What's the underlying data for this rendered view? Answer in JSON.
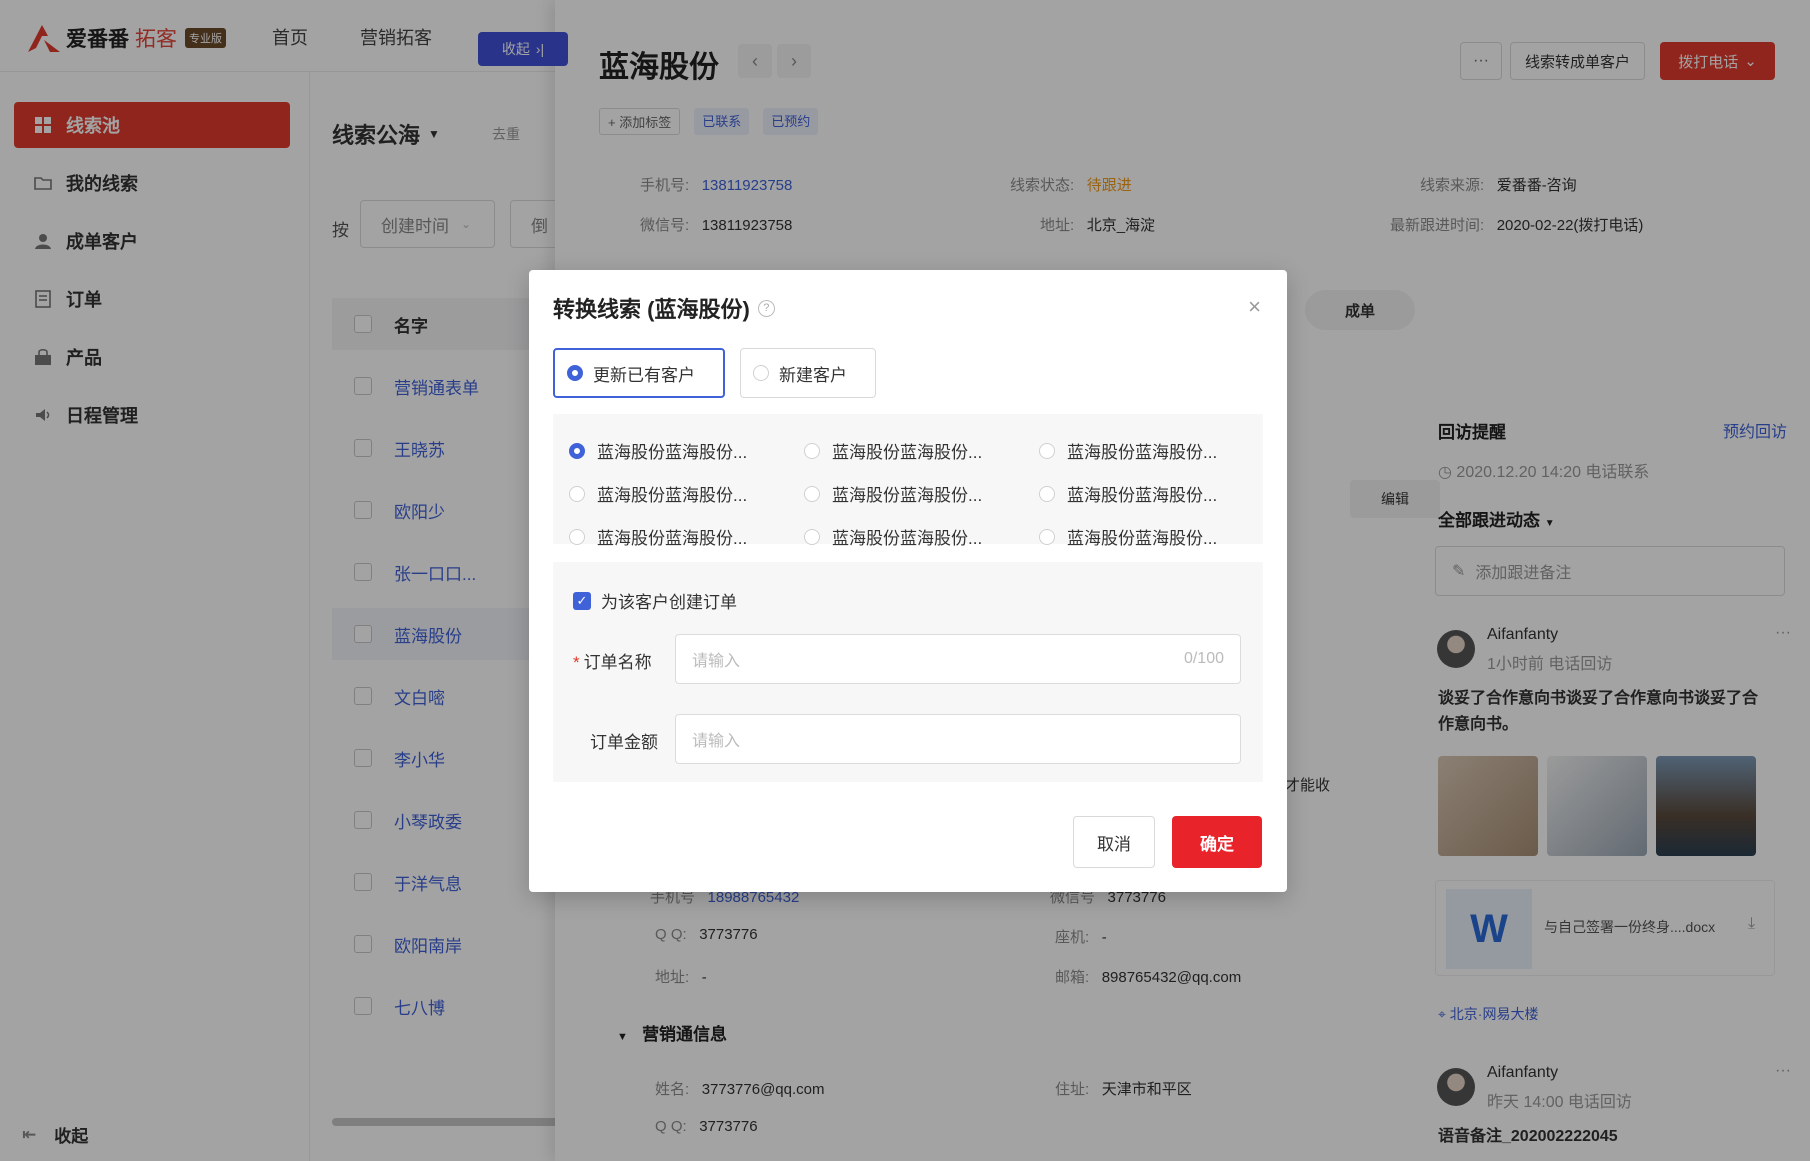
{
  "app": {
    "logo_name": "爱番番",
    "logo_sub": "拓客",
    "logo_badge": "专业版",
    "nav": [
      "首页",
      "营销拓客"
    ],
    "collapse_tag": "收起"
  },
  "sidebar": {
    "items": [
      {
        "label": "线索池",
        "icon": "grid-icon",
        "active": true
      },
      {
        "label": "我的线索",
        "icon": "folder-icon"
      },
      {
        "label": "成单客户",
        "icon": "user-icon"
      },
      {
        "label": "订单",
        "icon": "order-icon"
      },
      {
        "label": "产品",
        "icon": "bag-icon"
      },
      {
        "label": "日程管理",
        "icon": "speaker-icon"
      }
    ],
    "footer": "收起"
  },
  "list": {
    "title": "线索公海",
    "extra": "去重",
    "filter_label": "按",
    "filter_value": "创建时间",
    "filter_value2": "倒",
    "header": "名字",
    "rows": [
      "营销通表单",
      "王晓苏",
      "欧阳少",
      "张一口口...",
      "蓝海股份",
      "文白嘧",
      "李小华",
      "小琴政委",
      "于洋气息",
      "欧阳南岸",
      "七八博"
    ]
  },
  "detail": {
    "title": "蓝海股份",
    "prev": "‹",
    "next": "›",
    "more": "···",
    "convert": "线索转成单客户",
    "call": "拨打电话",
    "tags": [
      "+ 添加标签",
      "已联系",
      "已预约"
    ],
    "info": {
      "phone_k": "手机号:",
      "phone_v": "13811923758",
      "status_k": "线索状态:",
      "status_v": "待跟进",
      "source_k": "线索来源:",
      "source_v": "爱番番-咨询",
      "wechat_k": "微信号:",
      "wechat_v": "13811923758",
      "addr_k": "地址:",
      "addr_v": "北京_海淀",
      "latest_k": "最新跟进时间:",
      "latest_v": "2020-02-22(拨打电话)"
    },
    "pill": "成单",
    "edit": "编辑",
    "cut_text": "才能收",
    "lower": {
      "phone_k": "手机号",
      "phone_v": "18988765432",
      "wx_k": "微信号",
      "wx_v": "3773776",
      "qq_k": "Q Q:",
      "qq_v": "3773776",
      "tel_k": "座机:",
      "tel_v": "-",
      "addr_k": "地址:",
      "addr_v": "-",
      "mail_k": "邮箱:",
      "mail_v": "898765432@qq.com"
    },
    "section": "营销通信息",
    "mkt": {
      "name_k": "姓名:",
      "name_v": "3773776@qq.com",
      "live_k": "住址:",
      "live_v": "天津市和平区",
      "qq_k": "Q Q:",
      "qq_v": "3773776"
    },
    "feed": {
      "reminder_title": "回访提醒",
      "reminder_link": "预约回访",
      "reminder_time": "2020.12.20 14:20  电话联系",
      "all_title": "全部跟进动态",
      "note_placeholder": "添加跟进备注",
      "author1": "Aifanfanty",
      "meta1": "1小时前  电话回访",
      "text1": "谈妥了合作意向书谈妥了合作意向书谈妥了合作意向书。",
      "file_name": "与自己签署一份终身....docx",
      "location": "北京·网易大楼",
      "author2": "Aifanfanty",
      "meta2": "昨天 14:00  电话回访",
      "text2": "语音备注_202002222045"
    }
  },
  "modal": {
    "title": "转换线索 (蓝海股份)",
    "help": "?",
    "close": "×",
    "tab_existing": "更新已有客户",
    "tab_new": "新建客户",
    "choices": [
      "蓝海股份蓝海股份...",
      "蓝海股份蓝海股份...",
      "蓝海股份蓝海股份...",
      "蓝海股份蓝海股份...",
      "蓝海股份蓝海股份...",
      "蓝海股份蓝海股份...",
      "蓝海股份蓝海股份...",
      "蓝海股份蓝海股份...",
      "蓝海股份蓝海股份..."
    ],
    "create_order": "为该客户创建订单",
    "order_name_label": "订单名称",
    "order_name_placeholder": "请输入",
    "order_name_count": "0/100",
    "order_amount_label": "订单金额",
    "order_amount_placeholder": "请输入",
    "cancel": "取消",
    "ok": "确定"
  },
  "colors": {
    "accent": "#e03a2c",
    "primary": "#3f62d8",
    "warning": "#f29b18"
  }
}
